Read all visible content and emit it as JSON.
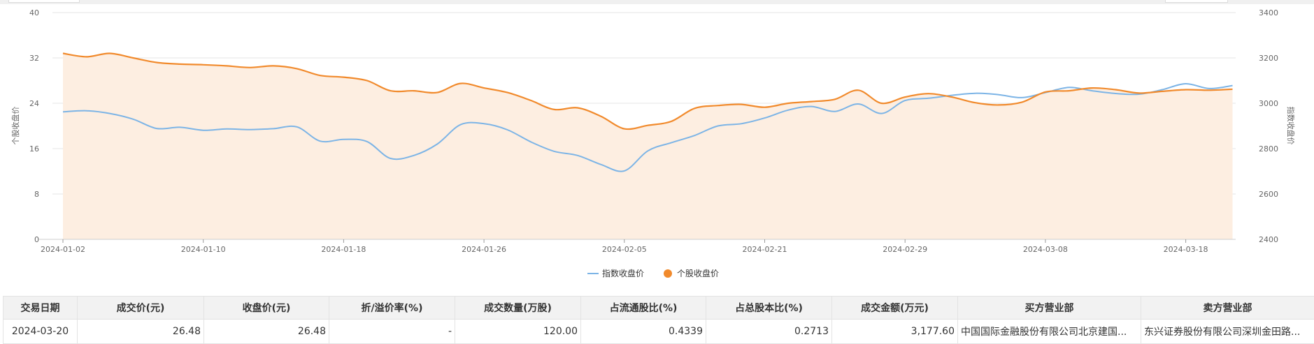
{
  "chart_data": {
    "type": "line",
    "x": [
      "2024-01-02",
      "2024-01-03",
      "2024-01-04",
      "2024-01-05",
      "2024-01-08",
      "2024-01-09",
      "2024-01-10",
      "2024-01-11",
      "2024-01-12",
      "2024-01-15",
      "2024-01-16",
      "2024-01-17",
      "2024-01-18",
      "2024-01-19",
      "2024-01-22",
      "2024-01-23",
      "2024-01-24",
      "2024-01-25",
      "2024-01-26",
      "2024-01-29",
      "2024-01-30",
      "2024-01-31",
      "2024-02-01",
      "2024-02-02",
      "2024-02-05",
      "2024-02-06",
      "2024-02-07",
      "2024-02-08",
      "2024-02-19",
      "2024-02-20",
      "2024-02-21",
      "2024-02-22",
      "2024-02-23",
      "2024-02-26",
      "2024-02-27",
      "2024-02-28",
      "2024-02-29",
      "2024-03-01",
      "2024-03-04",
      "2024-03-05",
      "2024-03-06",
      "2024-03-07",
      "2024-03-08",
      "2024-03-11",
      "2024-03-12",
      "2024-03-13",
      "2024-03-14",
      "2024-03-15",
      "2024-03-18",
      "2024-03-19",
      "2024-03-20"
    ],
    "x_ticks": [
      "2024-01-02",
      "2024-01-10",
      "2024-01-18",
      "2024-01-26",
      "2024-02-05",
      "2024-02-21",
      "2024-02-29",
      "2024-03-08",
      "2024-03-18"
    ],
    "series": [
      {
        "name": "指数收盘价",
        "axis": "right",
        "color": "#7cb4e6",
        "values": [
          2962,
          2967,
          2955,
          2930,
          2889,
          2894,
          2881,
          2887,
          2884,
          2888,
          2896,
          2833,
          2841,
          2831,
          2757,
          2770,
          2820,
          2906,
          2910,
          2883,
          2830,
          2788,
          2770,
          2730,
          2702,
          2790,
          2826,
          2858,
          2900,
          2910,
          2935,
          2970,
          2986,
          2964,
          2997,
          2955,
          3012,
          3022,
          3035,
          3044,
          3038,
          3025,
          3047,
          3070,
          3055,
          3043,
          3040,
          3060,
          3086,
          3065,
          3078
        ]
      },
      {
        "name": "个股收盘价",
        "axis": "left",
        "color": "#f18a2c",
        "area": true,
        "values": [
          32.8,
          32.2,
          32.8,
          32.0,
          31.2,
          30.9,
          30.8,
          30.6,
          30.3,
          30.6,
          30.1,
          28.9,
          28.6,
          28.0,
          26.2,
          26.2,
          25.9,
          27.5,
          26.7,
          25.9,
          24.5,
          22.9,
          23.2,
          21.7,
          19.5,
          20.1,
          20.8,
          23.1,
          23.6,
          23.8,
          23.3,
          24.0,
          24.3,
          24.7,
          26.3,
          24.0,
          25.1,
          25.7,
          25.1,
          24.1,
          23.7,
          24.2,
          26.0,
          26.2,
          26.7,
          26.4,
          25.8,
          26.1,
          26.4,
          26.3,
          26.48
        ]
      }
    ],
    "y_left": {
      "label": "个股收盘价",
      "ticks": [
        0,
        8,
        16,
        24,
        32,
        40
      ],
      "range": [
        0,
        40
      ]
    },
    "y_right": {
      "label": "指数收盘价",
      "ticks": [
        2400,
        2600,
        2800,
        3000,
        3200,
        3400
      ],
      "range": [
        2400,
        3400
      ]
    },
    "grid": true,
    "legend_position": "bottom-center"
  },
  "colors": {
    "index_line": "#7cb4e6",
    "stock_line": "#f18a2c",
    "stock_area": "#fdeee1",
    "table_header_bg": "#f2f2f2"
  },
  "table": {
    "headers": [
      "交易日期",
      "成交价(元)",
      "收盘价(元)",
      "折/溢价率(%)",
      "成交数量(万股)",
      "占流通股比(%)",
      "占总股本比(%)",
      "成交金额(万元)",
      "买方营业部",
      "卖方营业部"
    ],
    "rows": [
      [
        "2024-03-20",
        "26.48",
        "26.48",
        "-",
        "120.00",
        "0.4339",
        "0.2713",
        "3,177.60",
        "中国国际金融股份有限公司北京建国...",
        "东兴证券股份有限公司深圳金田路..."
      ]
    ]
  }
}
